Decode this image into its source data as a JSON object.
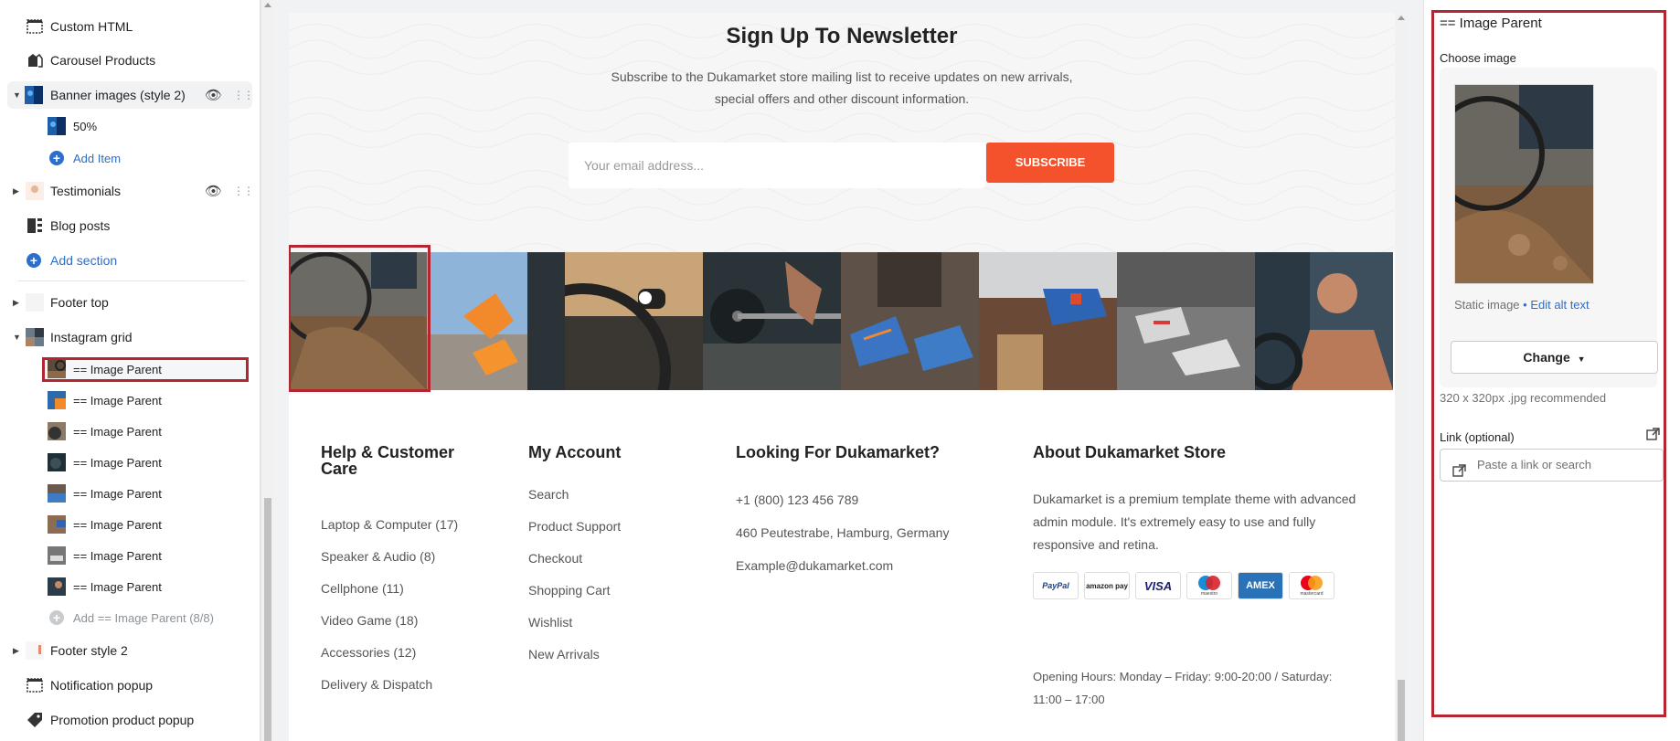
{
  "sidebar": {
    "items": [
      {
        "label": "Custom HTML",
        "icon": "custom-html-icon"
      },
      {
        "label": "Carousel Products",
        "icon": "carousel-products-icon"
      },
      {
        "label": "Banner images (style 2)",
        "icon": "banner-thumb-icon"
      },
      {
        "label": "50%",
        "icon": "banner-thumb-icon"
      },
      {
        "label": "Add Item",
        "icon": "add-circle-icon"
      },
      {
        "label": "Testimonials",
        "icon": "testimonials-thumb-icon"
      },
      {
        "label": "Blog posts",
        "icon": "blog-posts-icon"
      },
      {
        "label": "Add section",
        "icon": "add-circle-icon"
      },
      {
        "label": "Footer top",
        "icon": "footer-top-thumb-icon"
      },
      {
        "label": "Instagram grid",
        "icon": "instagram-grid-thumb-icon"
      },
      {
        "label": "== Image Parent",
        "icon": "image-thumb-icon"
      },
      {
        "label": "== Image Parent",
        "icon": "image-thumb-icon"
      },
      {
        "label": "== Image Parent",
        "icon": "image-thumb-icon"
      },
      {
        "label": "== Image Parent",
        "icon": "image-thumb-icon"
      },
      {
        "label": "== Image Parent",
        "icon": "image-thumb-icon"
      },
      {
        "label": "== Image Parent",
        "icon": "image-thumb-icon"
      },
      {
        "label": "== Image Parent",
        "icon": "image-thumb-icon"
      },
      {
        "label": "== Image Parent",
        "icon": "image-thumb-icon"
      },
      {
        "label": "Add == Image Parent (8/8)",
        "icon": "add-circle-icon"
      },
      {
        "label": "Footer style 2",
        "icon": "footer-style-thumb-icon"
      },
      {
        "label": "Notification popup",
        "icon": "notification-popup-icon"
      },
      {
        "label": "Promotion product popup",
        "icon": "tag-icon"
      }
    ]
  },
  "preview": {
    "newsletter": {
      "title": "Sign Up To Newsletter",
      "subtitle_line1": "Subscribe to the Dukamarket store mailing list to receive updates on new arrivals,",
      "subtitle_line2": "special offers and other discount information.",
      "email_placeholder": "Your email address...",
      "subscribe_label": "SUBSCRIBE"
    },
    "footer": {
      "col1": {
        "title": "Help & Customer Care",
        "links": [
          "Laptop & Computer (17)",
          "Speaker & Audio (8)",
          "Cellphone (11)",
          "Video Game (18)",
          "Accessories (12)",
          "Delivery & Dispatch"
        ]
      },
      "col2": {
        "title": "My Account",
        "links": [
          "Search",
          "Product Support",
          "Checkout",
          "Shopping Cart",
          "Wishlist",
          "New Arrivals"
        ]
      },
      "col3": {
        "title": "Looking For Dukamarket?",
        "lines": [
          "+1 (800) 123 456 789",
          "460 Peutestrabe, Hamburg, Germany",
          "Example@dukamarket.com"
        ]
      },
      "col4": {
        "title": "About Dukamarket Store",
        "text": "Dukamarket is a premium template theme with advanced admin module. It's extremely easy to use and fully responsive and retina.",
        "payments": [
          "PayPal",
          "amazon pay",
          "VISA",
          "maestro",
          "AMEX",
          "mastercard"
        ],
        "hours": "Opening Hours: Monday – Friday: 9:00-20:00 / Saturday: 11:00 – 17:00"
      }
    }
  },
  "settings": {
    "title": "== Image Parent",
    "choose_image_label": "Choose image",
    "static_image": "Static image",
    "edit_alt_text": "Edit alt text",
    "change_label": "Change",
    "recommendation": "320 x 320px .jpg recommended",
    "link_label": "Link (optional)",
    "link_placeholder": "Paste a link or search"
  },
  "colors": {
    "accent": "#2c6ecb",
    "highlight": "#b5252f",
    "subscribe": "#f4522c"
  }
}
